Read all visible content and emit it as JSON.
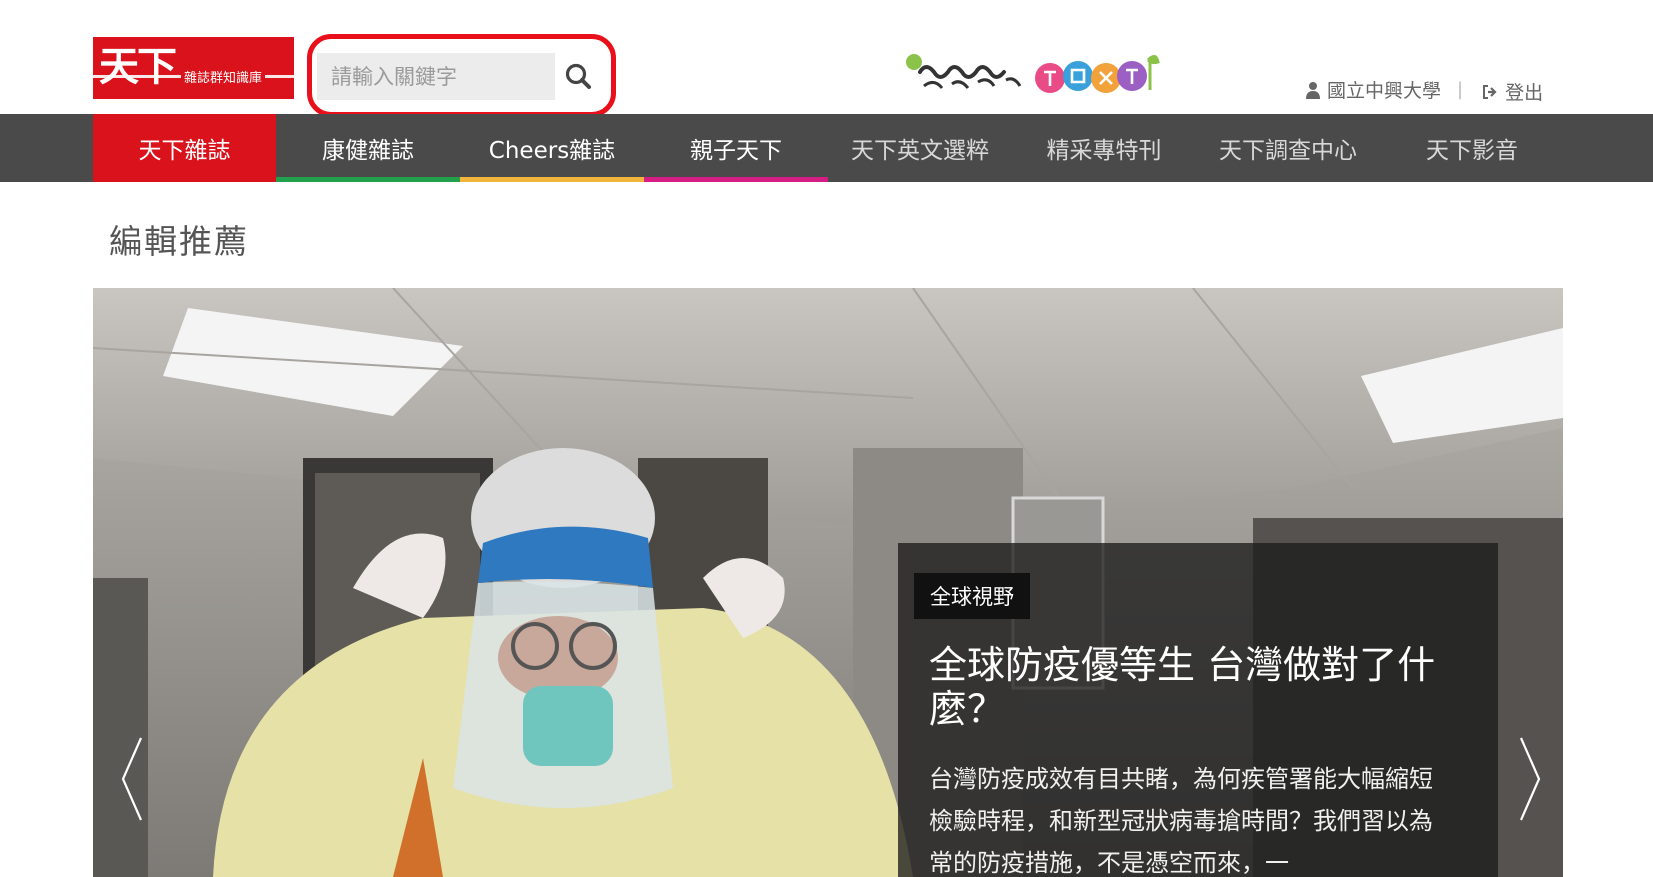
{
  "header": {
    "logo_main": "天下",
    "logo_sub": "雜誌群知識庫",
    "search_placeholder": "請輸入關鍵字",
    "user_name": "國立中興大學",
    "separator": "|",
    "logout_label": "登出"
  },
  "nav": {
    "items": [
      {
        "label": "天下雜誌",
        "accent": "#d9121b"
      },
      {
        "label": "康健雜誌",
        "accent": "#22a04b"
      },
      {
        "label": "Cheers雜誌",
        "accent": "#f0b53a"
      },
      {
        "label": "親子天下",
        "accent": "#d61d83"
      },
      {
        "label": "天下英文選粹"
      },
      {
        "label": "精采專特刊"
      },
      {
        "label": "天下調查中心"
      },
      {
        "label": "天下影音"
      }
    ]
  },
  "main": {
    "section_title": "編輯推薦",
    "carousel": {
      "tag": "全球視野",
      "headline": "全球防疫優等生 台灣做對了什麼？",
      "summary": "台灣防疫成效有目共睹，為何疾管署能大幅縮短檢驗時程，和新型冠狀病毒搶時間？我們習以為常的防疫措施，不是憑空而來，一"
    }
  },
  "colors": {
    "brand_red": "#d9121b",
    "nav_bg": "#4a4a4a",
    "highlight_red": "#e8101b"
  },
  "icons": [
    "search-icon",
    "user-icon",
    "logout-icon",
    "chevron-left-icon",
    "chevron-right-icon"
  ]
}
